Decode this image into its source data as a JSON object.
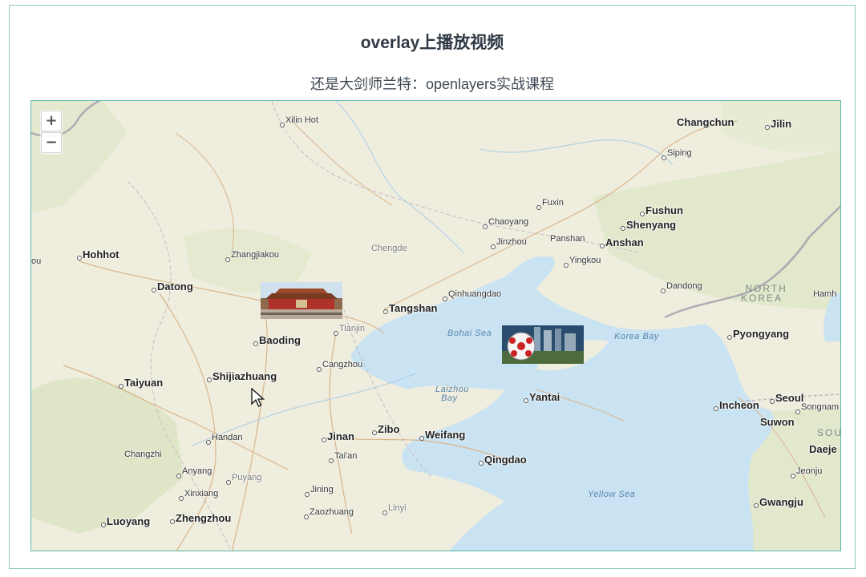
{
  "page": {
    "title": "overlay上播放视频",
    "subtitle": "还是大剑师兰特：openlayers实战课程"
  },
  "map": {
    "zoom_in_label": "+",
    "zoom_out_label": "−",
    "cities": [
      {
        "name": "Xilin Hot",
        "style": "minor"
      },
      {
        "name": "Changchun",
        "style": "major"
      },
      {
        "name": "Jilin",
        "style": "major"
      },
      {
        "name": "Siping",
        "style": "minor"
      },
      {
        "name": "Fuxin",
        "style": "minor"
      },
      {
        "name": "Fushun",
        "style": "major"
      },
      {
        "name": "Shenyang",
        "style": "major"
      },
      {
        "name": "Chaoyang",
        "style": "minor"
      },
      {
        "name": "Jinzhou",
        "style": "minor"
      },
      {
        "name": "Panshan",
        "style": "minor"
      },
      {
        "name": "Anshan",
        "style": "major"
      },
      {
        "name": "Yingkou",
        "style": "minor"
      },
      {
        "name": "Hohhot",
        "style": "major"
      },
      {
        "name": "Zhangjiakou",
        "style": "minor"
      },
      {
        "name": "Chengde",
        "style": "pale"
      },
      {
        "name": "Datong",
        "style": "major"
      },
      {
        "name": "Qinhuangdao",
        "style": "minor"
      },
      {
        "name": "Tangshan",
        "style": "major"
      },
      {
        "name": "Dandong",
        "style": "minor"
      },
      {
        "name": "Hamh",
        "style": "minor"
      },
      {
        "name": "Tianjin",
        "style": "pale"
      },
      {
        "name": "Baoding",
        "style": "major"
      },
      {
        "name": "Pyongyang",
        "style": "major"
      },
      {
        "name": "Taiyuan",
        "style": "major"
      },
      {
        "name": "Shijiazhuang",
        "style": "major"
      },
      {
        "name": "Cangzhou",
        "style": "minor"
      },
      {
        "name": "Yantai",
        "style": "major"
      },
      {
        "name": "Seoul",
        "style": "major"
      },
      {
        "name": "Incheon",
        "style": "major"
      },
      {
        "name": "Songnam",
        "style": "minor"
      },
      {
        "name": "Suwon",
        "style": "major"
      },
      {
        "name": "Handan",
        "style": "minor"
      },
      {
        "name": "Jinan",
        "style": "major"
      },
      {
        "name": "Zibo",
        "style": "major"
      },
      {
        "name": "Weifang",
        "style": "major"
      },
      {
        "name": "Daeje",
        "style": "major"
      },
      {
        "name": "Changzhi",
        "style": "minor"
      },
      {
        "name": "Tai'an",
        "style": "minor"
      },
      {
        "name": "Qingdao",
        "style": "major"
      },
      {
        "name": "Anyang",
        "style": "minor"
      },
      {
        "name": "Puyang",
        "style": "pale"
      },
      {
        "name": "Jeonju",
        "style": "minor"
      },
      {
        "name": "Xinxiang",
        "style": "minor"
      },
      {
        "name": "Jining",
        "style": "minor"
      },
      {
        "name": "Luoyang",
        "style": "major"
      },
      {
        "name": "Zhengzhou",
        "style": "major"
      },
      {
        "name": "Zaozhuang",
        "style": "minor"
      },
      {
        "name": "Linyi",
        "style": "pale"
      },
      {
        "name": "Gwangju",
        "style": "major"
      },
      {
        "name": "ou",
        "style": "minor"
      }
    ],
    "water_labels": [
      "Bohai Sea",
      "Korea Bay",
      "Laizhou Bay",
      "Yellow Sea"
    ],
    "country_labels": [
      "NORTH KOREA",
      "SOU"
    ],
    "overlays": [
      {
        "name": "Tiananmen",
        "type": "image"
      },
      {
        "name": "Video",
        "type": "video"
      }
    ]
  }
}
